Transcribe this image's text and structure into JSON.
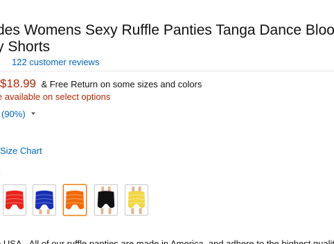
{
  "product": {
    "title_line_1": "des Womens Sexy Ruffle Panties Tanga Dance Bloomers",
    "title_line_2": "y Shorts",
    "reviews_link": "122 customer reviews"
  },
  "pricing": {
    "price": "$18.99",
    "free_return": "& Free Return on some sizes and colors",
    "availability_note": "e available on select options"
  },
  "rating": {
    "percent_text": "(90%)"
  },
  "size": {
    "chart_link": "Size Chart"
  },
  "color": {
    "label": "y",
    "swatches": [
      {
        "name": "Red",
        "color": "#e8231b"
      },
      {
        "name": "Blue",
        "color": "#1730b5"
      },
      {
        "name": "Orange",
        "color": "#f26a0c"
      },
      {
        "name": "Black",
        "color": "#111111"
      },
      {
        "name": "Yellow",
        "color": "#f2d645"
      }
    ]
  },
  "description": {
    "teaser": "e USA - All of our ruffle panties are made in America, and adhere to the highest quality"
  }
}
